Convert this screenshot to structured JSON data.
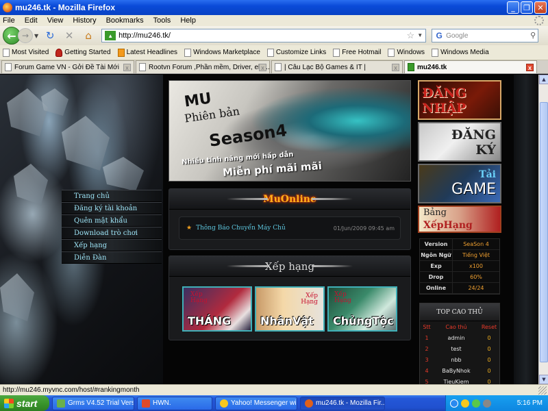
{
  "window": {
    "title": "mu246.tk - Mozilla Firefox",
    "buttons": [
      "_",
      "❐",
      "✕"
    ]
  },
  "menu": [
    "File",
    "Edit",
    "View",
    "History",
    "Bookmarks",
    "Tools",
    "Help"
  ],
  "nav": {
    "url": "http://mu246.tk/",
    "search_placeholder": "Google"
  },
  "bookmarks": [
    {
      "label": "Most Visited",
      "icon": "bookmark-icon"
    },
    {
      "label": "Getting Started",
      "icon": "firefox-hat-icon"
    },
    {
      "label": "Latest Headlines",
      "icon": "rss-icon"
    },
    {
      "label": "Windows Marketplace",
      "icon": "page-icon"
    },
    {
      "label": "Customize Links",
      "icon": "page-icon"
    },
    {
      "label": "Free Hotmail",
      "icon": "page-icon"
    },
    {
      "label": "Windows",
      "icon": "page-icon"
    },
    {
      "label": "Windows Media",
      "icon": "page-icon"
    }
  ],
  "tabs": [
    {
      "label": "Forum Game VN - Gởi Đề Tài Mới",
      "active": false
    },
    {
      "label": "Rootvn Forum ,Phần mềm, Driver, ebo...",
      "active": false
    },
    {
      "label": "| Câu Lạc Bộ Games & IT |",
      "active": false
    },
    {
      "label": "mu246.tk",
      "active": true
    }
  ],
  "page": {
    "left_menu": [
      "Trang chủ",
      "Đăng ký tài khoản",
      "Quên mật khẩu",
      "Download trò chơi",
      "Xếp hạng",
      "Diễn Đàn"
    ],
    "banner": {
      "line1": "MU",
      "line2": "Phiên bản",
      "line3": "Season4",
      "line4": "Nhiều tính năng mới hấp dẫn",
      "line5": "Miễn phí mãi mãi"
    },
    "news_panel": {
      "title": "MuOnline",
      "items": [
        {
          "title": "Thông Báo Chuyển Máy Chủ",
          "date": "01/Jun/2009 09:45 am"
        }
      ]
    },
    "ranking_panel": {
      "title": "Xếp hạng",
      "images": [
        {
          "small": "Xếp\nHạng",
          "big": "THÁNG"
        },
        {
          "small": "Xếp\nHạng",
          "big": "NhânVật"
        },
        {
          "small": "Xếp\nHạng",
          "big": "ChủngTộc"
        }
      ]
    },
    "right_buttons": {
      "login": "ĐĂNG\nNHẬP",
      "register": "ĐĂNG\nKÝ",
      "download_top": "Tải",
      "download_bottom": "GAME",
      "rank_top": "Bảng",
      "rank_bottom": "XếpHạng"
    },
    "server_info": [
      {
        "key": "Version",
        "value": "SeaSon 4"
      },
      {
        "key": "Ngôn Ngữ",
        "value": "Tiếng Việt"
      },
      {
        "key": "Exp",
        "value": "x100"
      },
      {
        "key": "Drop",
        "value": "60%"
      },
      {
        "key": "Online",
        "value": "24/24"
      }
    ],
    "top_players": {
      "title": "TOP CAO THỦ",
      "headers": [
        "Stt",
        "Cao thủ",
        "Reset"
      ],
      "rows": [
        [
          "1",
          "admin",
          "0"
        ],
        [
          "2",
          "test",
          "0"
        ],
        [
          "3",
          "nbb",
          "0"
        ],
        [
          "4",
          "BaByNhok",
          "0"
        ],
        [
          "5",
          "TieuKiem",
          "0"
        ]
      ]
    }
  },
  "status": "http://mu246.myvnc.com/host/#rankingmonth",
  "taskbar": {
    "start": "start",
    "tasks": [
      {
        "label": "Grms V4.52 Trial Versi...",
        "color": "#6ab04c"
      },
      {
        "label": "HWN.",
        "color": "#e04a2a"
      },
      {
        "label": "Yahoo! Messenger wi...",
        "color": "#f8c81e"
      },
      {
        "label": "mu246.tk - Mozilla Fir...",
        "color": "#e0601a"
      }
    ],
    "clock": "5:16 PM"
  }
}
